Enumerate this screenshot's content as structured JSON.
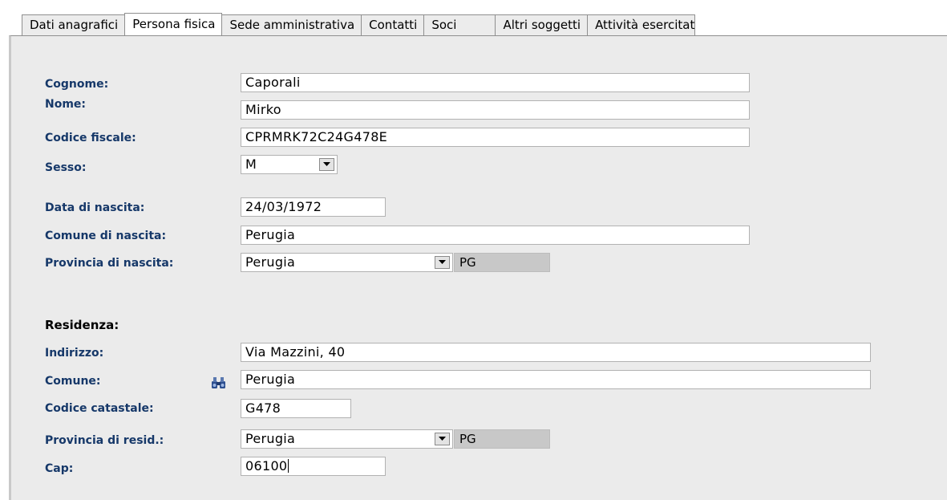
{
  "tabs": [
    {
      "label": "Dati anagrafici"
    },
    {
      "label": "Persona fisica"
    },
    {
      "label": "Sede amministrativa"
    },
    {
      "label": "Contatti"
    },
    {
      "label": "Soci"
    },
    {
      "label": "Altri soggetti"
    },
    {
      "label": "Attività esercitat"
    }
  ],
  "active_tab": "Persona fisica",
  "persona": {
    "cognome": {
      "label": "Cognome:",
      "value": "Caporali"
    },
    "nome": {
      "label": "Nome:",
      "value": "Mirko"
    },
    "codice_fiscale": {
      "label": "Codice fiscale:",
      "value": "CPRMRK72C24G478E"
    },
    "sesso": {
      "label": "Sesso:",
      "value": "M"
    },
    "data_nascita": {
      "label": "Data di nascita:",
      "value": "24/03/1972"
    },
    "comune_nascita": {
      "label": "Comune di nascita:",
      "value": "Perugia"
    },
    "provincia_nascita": {
      "label": "Provincia di nascita:",
      "value": "Perugia",
      "sigla": "PG"
    }
  },
  "residenza": {
    "heading": "Residenza:",
    "indirizzo": {
      "label": "Indirizzo:",
      "value": "Via Mazzini, 40"
    },
    "comune": {
      "label": "Comune:",
      "value": "Perugia",
      "icon": "binoculars-icon"
    },
    "codice_catastale": {
      "label": "Codice catastale:",
      "value": "G478"
    },
    "provincia": {
      "label": "Provincia di resid.:",
      "value": "Perugia",
      "sigla": "PG"
    },
    "cap": {
      "label": "Cap:",
      "value": "06100"
    }
  },
  "colors": {
    "label": "#163869",
    "panel_bg": "#ebebeb",
    "readonly_bg": "#c8c8c8"
  }
}
